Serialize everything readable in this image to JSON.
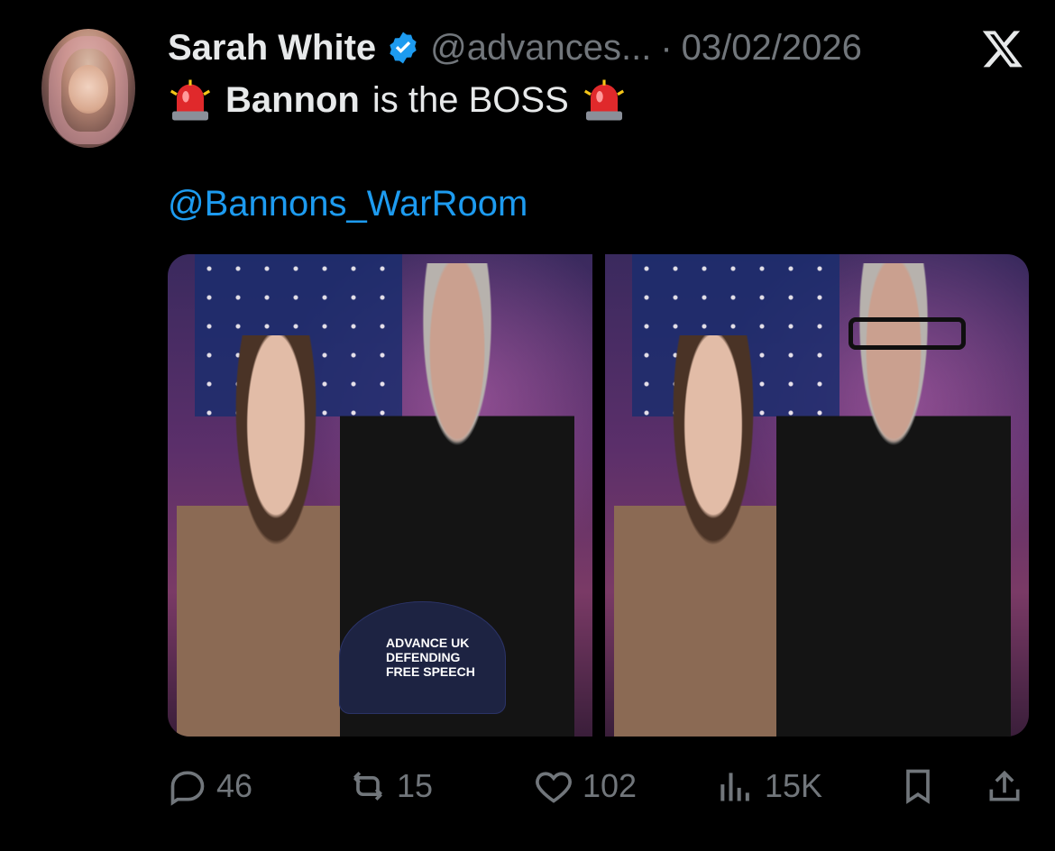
{
  "author": {
    "name": "Sarah White",
    "handle": "@advances...",
    "separator": "·",
    "date": "03/02/2026"
  },
  "tweet": {
    "text_bold": "Bannon",
    "text_rest": "is the BOSS",
    "mention": "@Bannons_WarRoom"
  },
  "media": {
    "cap_text_line1": "ADVANCE UK",
    "cap_text_line2": "DEFENDING",
    "cap_text_line3": "FREE SPEECH"
  },
  "actions": {
    "replies": "46",
    "retweets": "15",
    "likes": "102",
    "views": "15K"
  },
  "colors": {
    "background": "#000000",
    "text": "#e7e9ea",
    "muted": "#71767b",
    "link": "#1d9bf0",
    "verified": "#1d9bf0"
  },
  "icons": {
    "verified": "verified-badge-icon",
    "x_logo": "x-logo-icon",
    "siren": "police-light-emoji-icon",
    "reply": "speech-bubble-icon",
    "retweet": "retweet-arrows-icon",
    "like": "heart-icon",
    "views": "bar-chart-icon",
    "bookmark": "bookmark-icon",
    "share": "share-upload-icon"
  }
}
